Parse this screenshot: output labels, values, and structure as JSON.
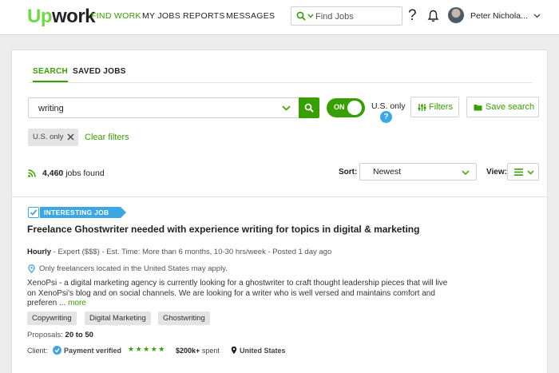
{
  "brand": {
    "logo_up": "Up",
    "logo_rest": "work",
    "accent": "#37a000",
    "info_blue": "#3ba7e4"
  },
  "nav": {
    "items": [
      "FIND WORK",
      "MY JOBS",
      "REPORTS",
      "MESSAGES"
    ],
    "active": "FIND WORK"
  },
  "header": {
    "search_placeholder": "Find Jobs",
    "help": "?",
    "user_name": "Peter Nichola...",
    "icons": [
      "search-icon",
      "chevron-down-icon",
      "bell-icon",
      "avatar"
    ]
  },
  "tabs": [
    {
      "label": "SEARCH",
      "active": true
    },
    {
      "label": "SAVED JOBS",
      "active": false
    }
  ],
  "search": {
    "keyword": "writing",
    "toggle_label": "ON",
    "toggle_on": true,
    "us_only_label": "U.S. only",
    "help": "?",
    "filters_label": "Filters",
    "save_search_label": "Save search"
  },
  "active_filters": {
    "chip_label": "U.S. only",
    "clear_label": "Clear filters"
  },
  "results": {
    "count": "4,460",
    "count_suffix": "jobs found",
    "sort_label": "Sort:",
    "sort_value": "Newest",
    "view_label": "View:"
  },
  "job": {
    "ribbon": "INTERESTING JOB",
    "title": "Freelance Ghostwriter needed with experience writing for topics in digital & marketing",
    "type": "Hourly",
    "meta_rest": " - Expert ($$$) - Est. Time: More than 6 months, 10-30 hrs/week - Posted 1 day ago",
    "location_note": "Only freelancers located in the United States may apply.",
    "description": "XenoPsi - a digital marketing agency is currently looking for a ghostwriter to craft thought leadership pieces that will live on XenoPsi's blog and on social channels. We are looking for a writer who is well versed and maintains comfort and preferen ...",
    "more_label": "more",
    "tags": [
      "Copywriting",
      "Digital Marketing",
      "Ghostwriting"
    ],
    "proposals_label": "Proposals:",
    "proposals_value": "20 to 50",
    "client_label": "Client:",
    "payment_verified": "Payment verified",
    "rating_stars": 5,
    "stars": "★★★★★",
    "spent_value": "$200k+",
    "spent_suffix": "spent",
    "client_location": "United States"
  }
}
